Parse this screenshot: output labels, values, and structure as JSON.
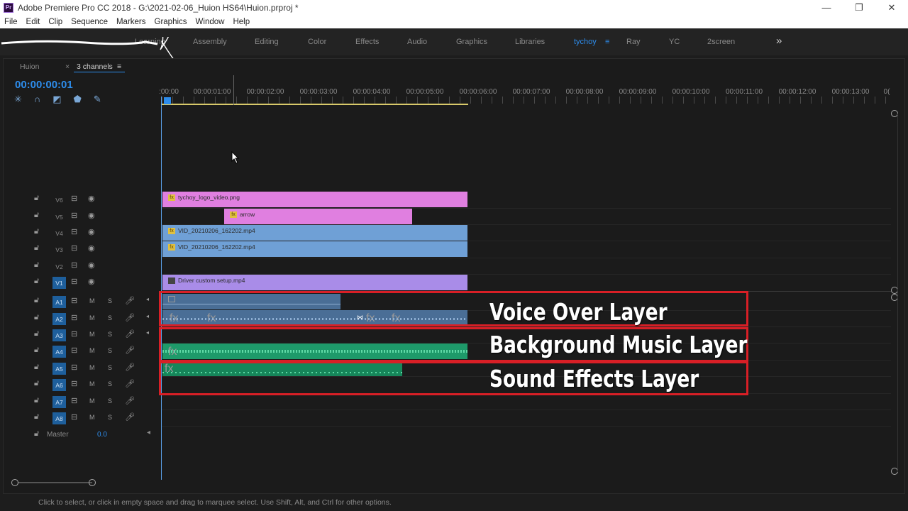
{
  "window": {
    "title": "Adobe Premiere Pro CC 2018 - G:\\2021-02-06_Huion HS64\\Huion.prproj *",
    "logo": "Pr",
    "minimize": "—",
    "maximize": "❐",
    "close": "✕"
  },
  "menu": [
    "File",
    "Edit",
    "Clip",
    "Sequence",
    "Markers",
    "Graphics",
    "Window",
    "Help"
  ],
  "workspaces": {
    "items": [
      "Learning",
      "Assembly",
      "Editing",
      "Color",
      "Effects",
      "Audio",
      "Graphics",
      "Libraries",
      "tychoy",
      "Ray",
      "YC",
      "2screen"
    ],
    "active": "tychoy",
    "active_menu_icon": "≡",
    "more": "»"
  },
  "timeline": {
    "tab_inactive": "Huion",
    "tab_close": "×",
    "tab_active": "3 channels",
    "tab_menu": "≡",
    "timecode": "00:00:00:01",
    "ruler": [
      ":00:00",
      "00:00:01:00",
      "00:00:02:00",
      "00:00:03:00",
      "00:00:04:00",
      "00:00:05:00",
      "00:00:06:00",
      "00:00:07:00",
      "00:00:08:00",
      "00:00:09:00",
      "00:00:10:00",
      "00:00:11:00",
      "00:00:12:00",
      "00:00:13:00",
      "0("
    ]
  },
  "video_tracks": [
    {
      "name": "V6",
      "on": false
    },
    {
      "name": "V5",
      "on": false
    },
    {
      "name": "V4",
      "on": false
    },
    {
      "name": "V3",
      "on": false
    },
    {
      "name": "V2",
      "on": false
    },
    {
      "name": "V1",
      "on": true
    }
  ],
  "audio_tracks": [
    {
      "name": "A1",
      "on": true
    },
    {
      "name": "A2",
      "on": true
    },
    {
      "name": "A3",
      "on": true
    },
    {
      "name": "A4",
      "on": true
    },
    {
      "name": "A5",
      "on": true
    },
    {
      "name": "A6",
      "on": true
    },
    {
      "name": "A7",
      "on": true
    },
    {
      "name": "A8",
      "on": true
    }
  ],
  "audio_buttons": {
    "mute": "M",
    "solo": "S"
  },
  "master": {
    "label": "Master",
    "value": "0.0"
  },
  "clips": {
    "v6": "tychoy_logo_video.png",
    "v5": "arrow",
    "v4": "VID_20210206_162202.mp4",
    "v3": "VID_20210206_162202.mp4",
    "v1": "Driver custom setup.mp4",
    "fx": "fx"
  },
  "colors": {
    "video_pink": "#e07fe0",
    "video_blue": "#6fa0d6",
    "video_purple": "#a98ce8",
    "audio_vo": "#4a6e96",
    "audio_music": "#1e9a6a",
    "audio_sfx": "#16865a",
    "highlight_red": "#d81f26",
    "accent_blue": "#2d8ceb"
  },
  "annotations": [
    "Voice Over Layer",
    "Background Music Layer",
    "Sound Effects Layer"
  ],
  "status": "Click to select, or click in empty space and drag to marquee select. Use Shift, Alt, and Ctrl for other options."
}
